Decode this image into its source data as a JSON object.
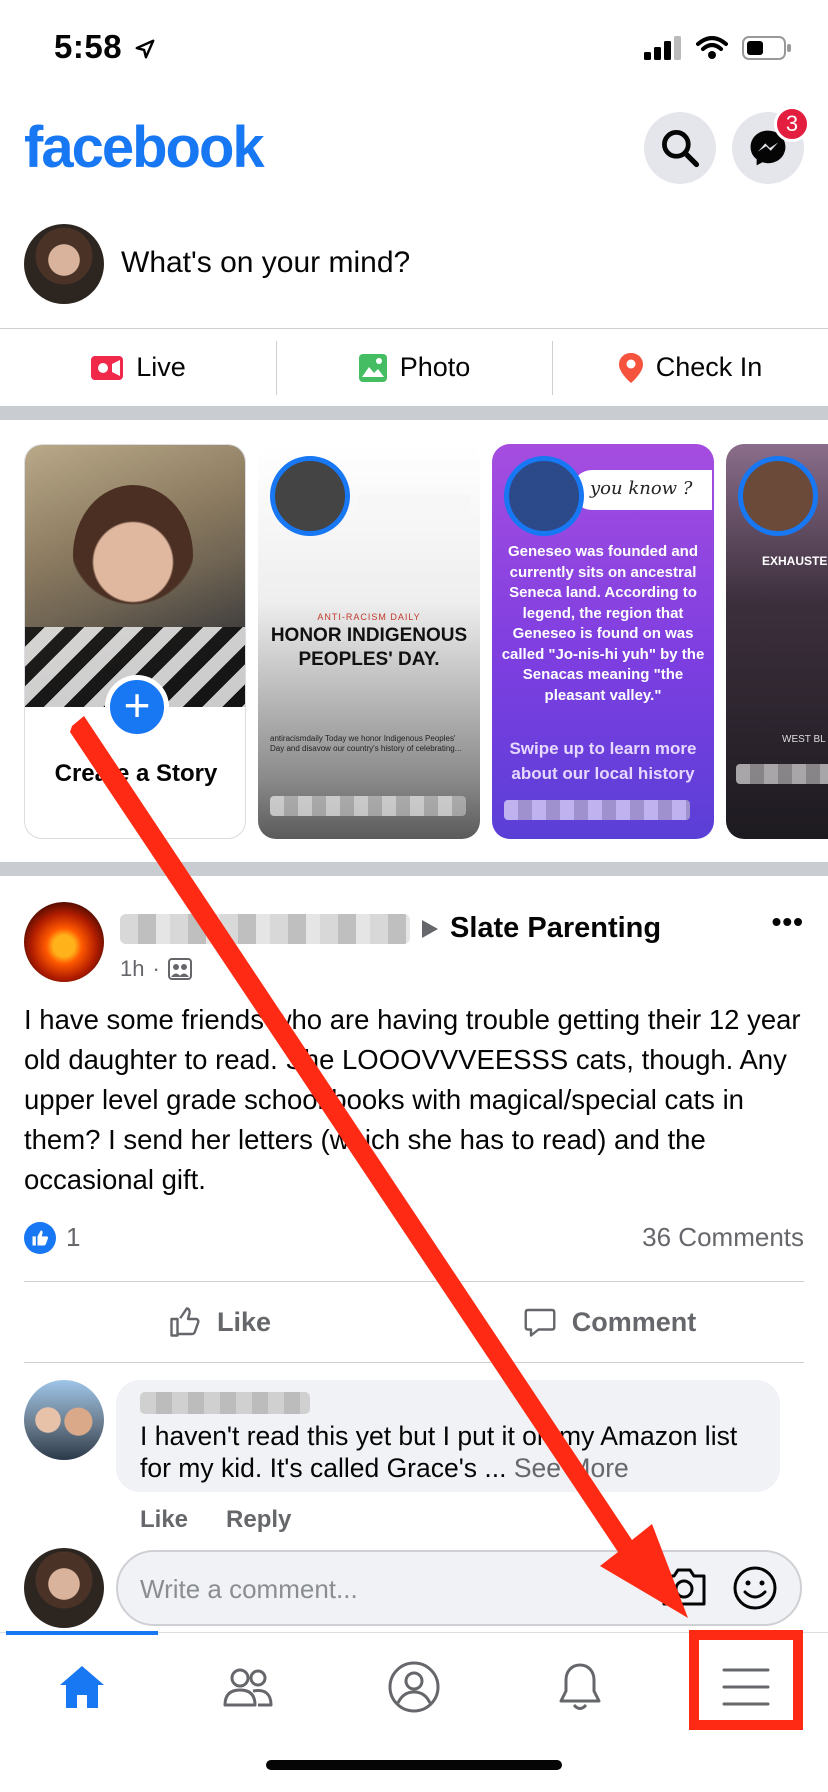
{
  "status_bar": {
    "time": "5:58"
  },
  "header": {
    "logo": "facebook",
    "messenger_badge": "3",
    "icons": [
      "search-icon",
      "messenger-icon"
    ]
  },
  "composer": {
    "placeholder": "What's on your mind?"
  },
  "composer_actions": [
    {
      "label": "Live",
      "icon": "live-video-icon",
      "color": "#f02849"
    },
    {
      "label": "Photo",
      "icon": "photo-icon",
      "color": "#45bd62"
    },
    {
      "label": "Check In",
      "icon": "location-pin-icon",
      "color": "#f5533d"
    }
  ],
  "stories": {
    "create_label": "Create a Story",
    "story2": {
      "kicker": "ANTI-RACISM DAILY",
      "title": "HONOR INDIGENOUS PEOPLES' DAY.",
      "caption": "antiracismdaily Today we honor Indigenous Peoples' Day and disavow our country's history of celebrating..."
    },
    "story3": {
      "pill": "you know ?",
      "text": "Geneseo was founded and currently sits on ancestral Seneca land. According to legend, the region that Geneseo is found on was called \"Jo-nis-hi yuh\" by the Senacas meaning \"the pleasant valley.\"",
      "swipe": "Swipe up to learn more about our local history"
    },
    "story4": {
      "label": "EXHAUSTED",
      "bottom": "WEST BL"
    }
  },
  "post": {
    "group": "Slate Parenting",
    "time": "1h",
    "body": "I have some friends who are having trouble getting their 12 year old daughter to read.  She LOOOVVVEESSS cats, though.  Any upper level grade school books with magical/special cats in them?  I send her letters (which she has to read) and the occasional gift.",
    "like_count": "1",
    "comments": "36 Comments",
    "like_label": "Like",
    "comment_label": "Comment"
  },
  "comment": {
    "text": "I haven't read this yet but I put it on my Amazon list for my kid. It's called Grace's ...",
    "see_more": "See More",
    "like": "Like",
    "reply": "Reply"
  },
  "write_comment": {
    "placeholder": "Write a comment..."
  },
  "tab_bar": {
    "tabs": [
      "home-icon",
      "friends-icon",
      "profile-icon",
      "notifications-icon",
      "menu-icon"
    ],
    "active_color": "#1877f2"
  },
  "annotation": {
    "color": "#ff2a14"
  }
}
